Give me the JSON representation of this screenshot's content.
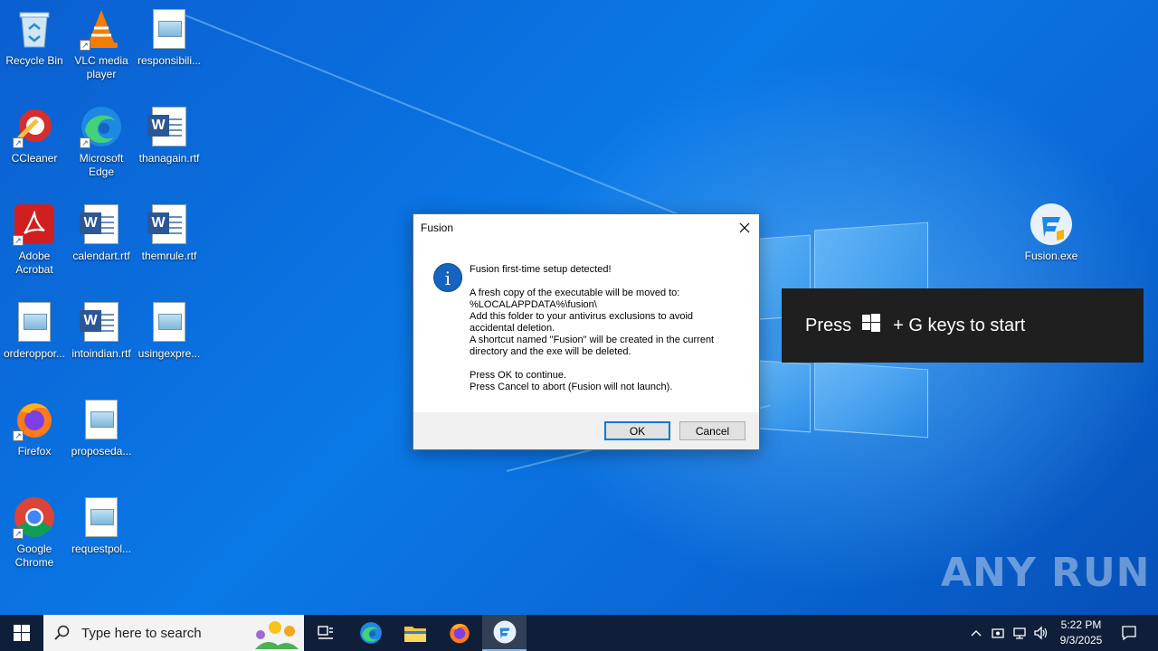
{
  "desktop": {
    "icons": [
      {
        "label": "Recycle Bin"
      },
      {
        "label": "VLC media player"
      },
      {
        "label": "responsibili..."
      },
      {
        "label": "CCleaner"
      },
      {
        "label": "Microsoft Edge"
      },
      {
        "label": "thanagain.rtf"
      },
      {
        "label": "Adobe Acrobat"
      },
      {
        "label": "calendart.rtf"
      },
      {
        "label": "themrule.rtf"
      },
      {
        "label": "orderoppor..."
      },
      {
        "label": "intoindian.rtf"
      },
      {
        "label": "usingexpre..."
      },
      {
        "label": "Firefox"
      },
      {
        "label": "proposeda..."
      },
      {
        "label": "Google Chrome"
      },
      {
        "label": "requestpol..."
      },
      {
        "label": "Fusion.exe"
      }
    ]
  },
  "dialog": {
    "title": "Fusion",
    "lines": [
      "Fusion first-time setup detected!",
      "",
      "A fresh copy of the executable will be moved to:",
      "%LOCALAPPDATA%\\fusion\\",
      "Add this folder to your antivirus exclusions to avoid",
      "accidental deletion.",
      "A shortcut named \"Fusion\" will be created in the current",
      "directory and the exe will be deleted.",
      "",
      "Press OK to continue.",
      "Press Cancel to abort (Fusion will not launch)."
    ],
    "ok_label": "OK",
    "cancel_label": "Cancel"
  },
  "gamebar": {
    "prefix": "Press",
    "suffix": "+ G keys to start"
  },
  "watermark": "ANY RUN",
  "taskbar": {
    "search_placeholder": "Type here to search",
    "time": "5:22 PM",
    "date": "9/3/2025"
  },
  "colors": {
    "accent": "#0078d7",
    "info_icon": "#1565c0",
    "taskbar": "#0f1f3a"
  }
}
